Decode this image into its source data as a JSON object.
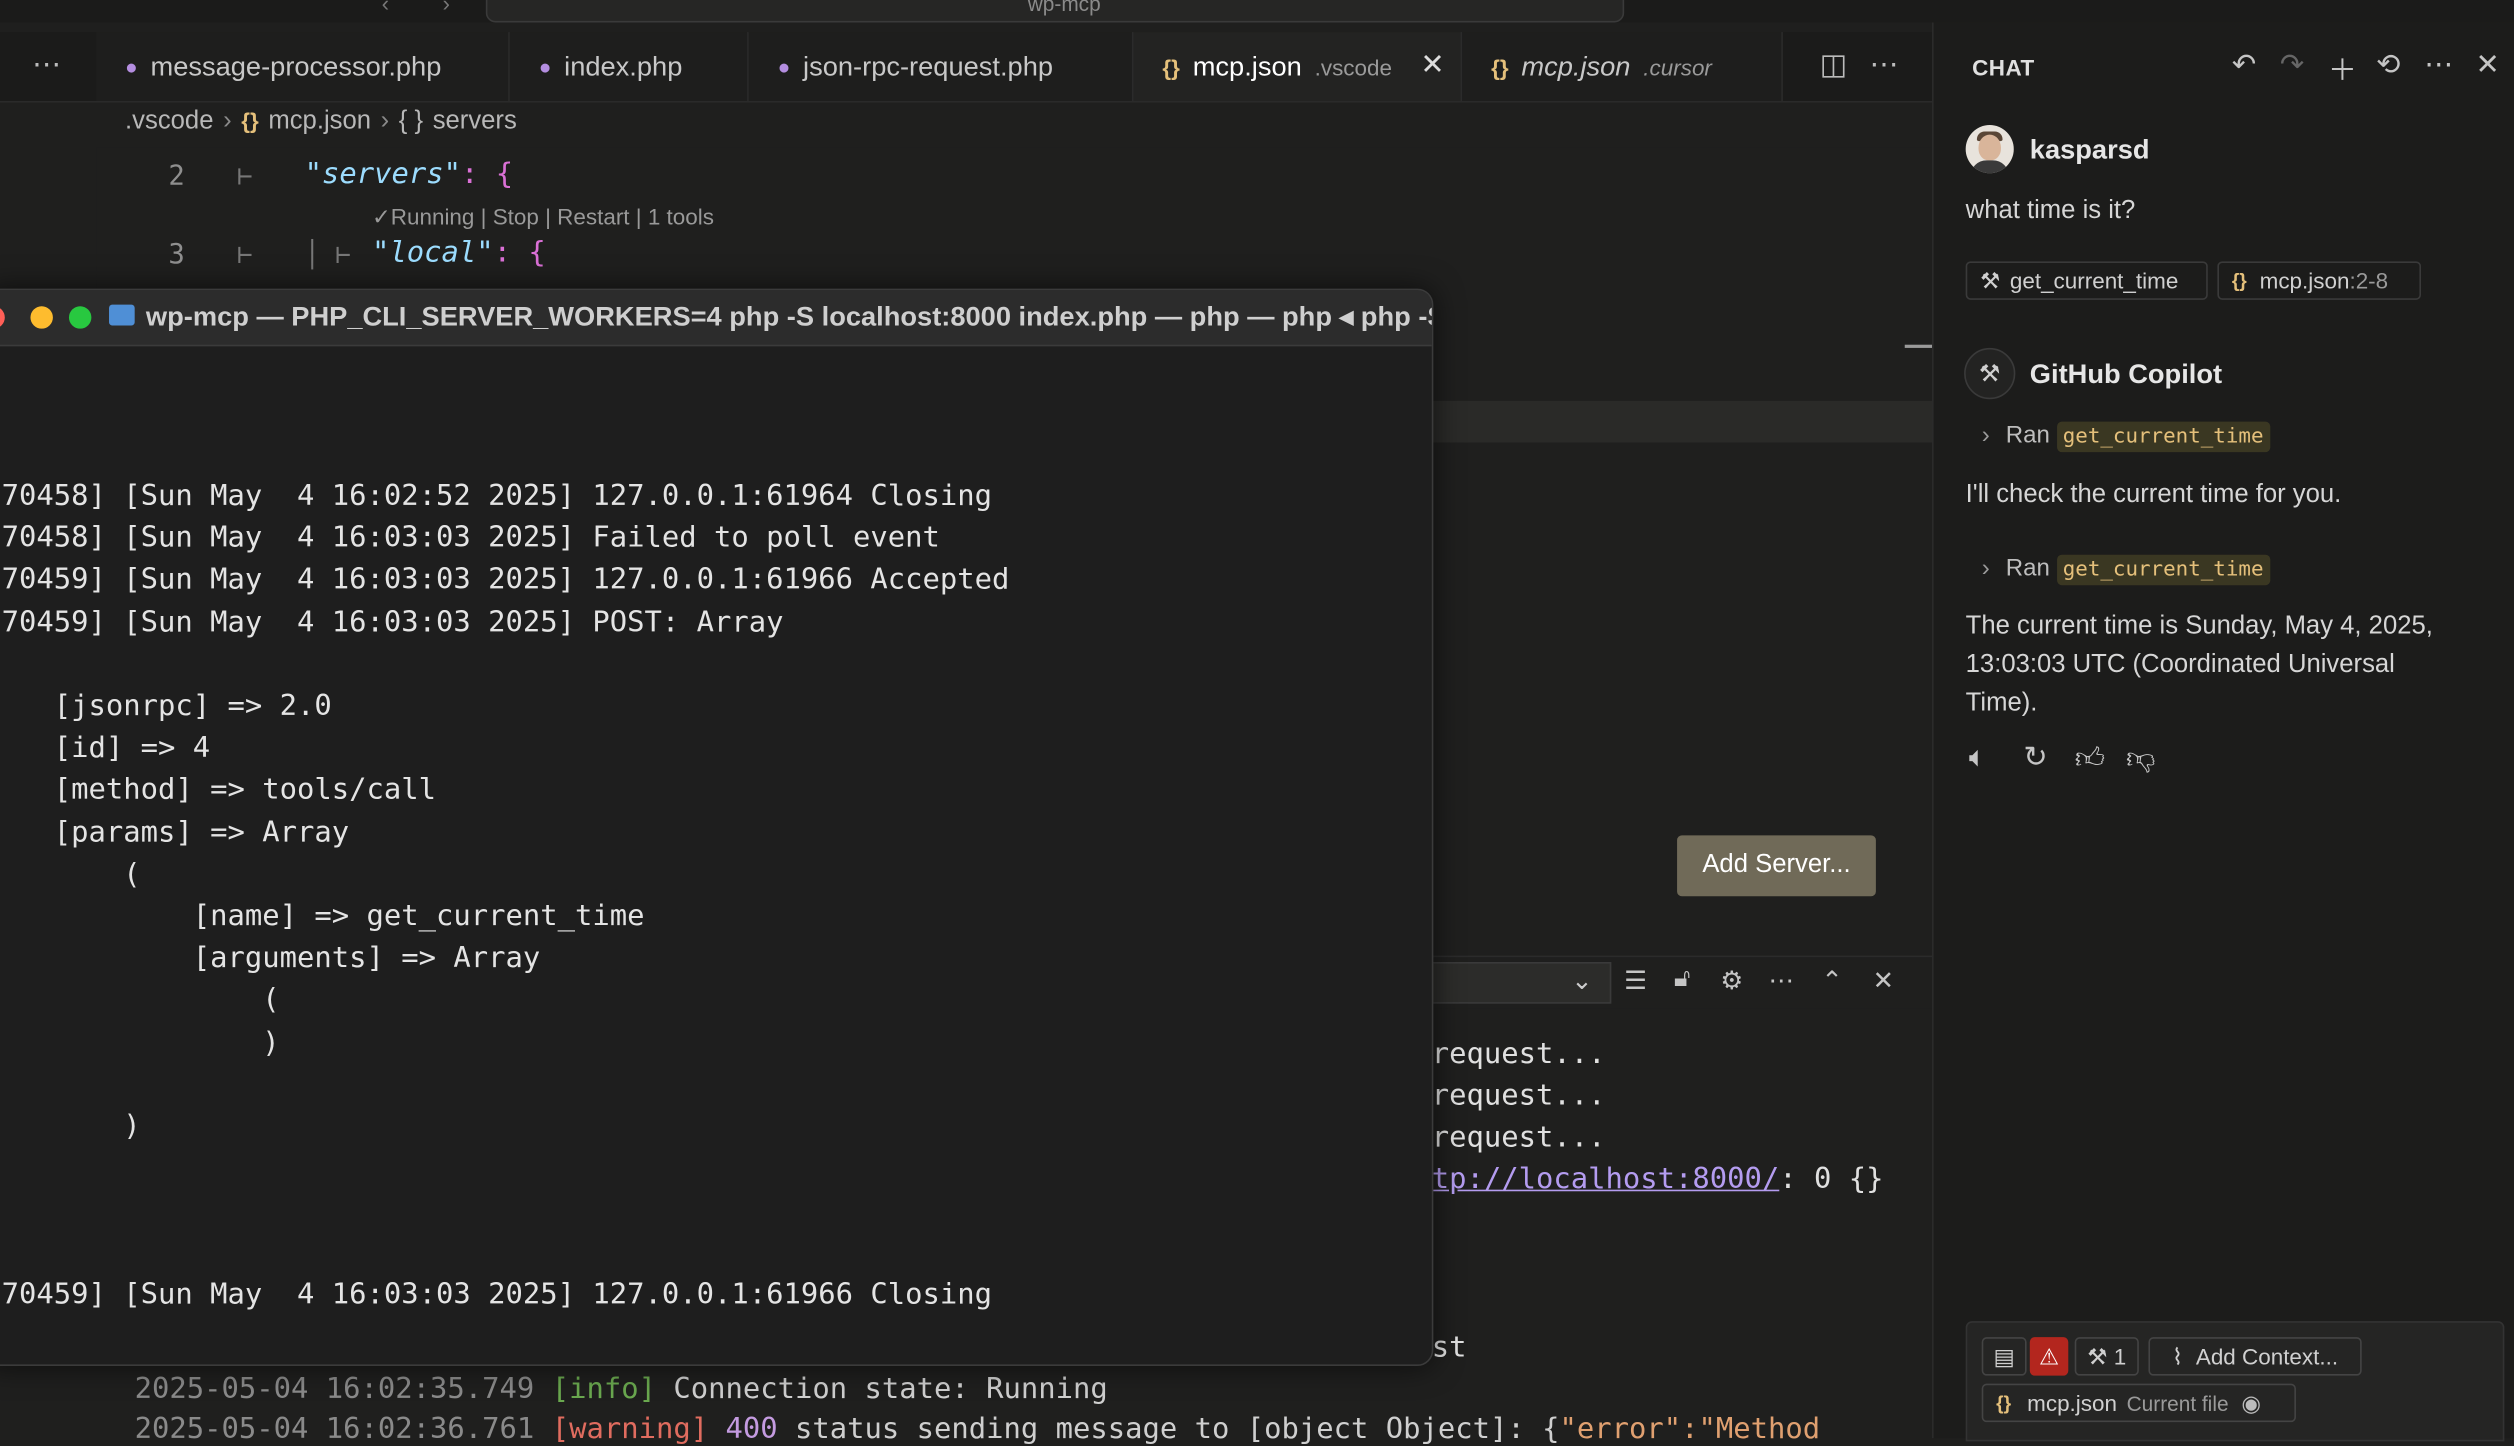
{
  "titlebar": {
    "search_text": "wp-mcp"
  },
  "tabs": [
    {
      "label": "message-processor.php",
      "icon": "php-elephant-icon"
    },
    {
      "label": "index.php",
      "icon": "php-elephant-icon"
    },
    {
      "label": "json-rpc-request.php",
      "icon": "php-elephant-icon"
    },
    {
      "label": "mcp.json",
      "sub": ".vscode",
      "icon": "json-braces-icon",
      "active": true
    },
    {
      "label": "mcp.json",
      "sub": ".cursor",
      "icon": "json-braces-icon",
      "italic": true
    }
  ],
  "breadcrumb": {
    "folder": ".vscode",
    "file": "mcp.json",
    "symbol": "servers",
    "symbol_icon": "{ }"
  },
  "editor": {
    "line2_num": "2",
    "line2_key": "\"servers\"",
    "line2_rest": ": {",
    "codelens": "✓Running | Stop | Restart | 1 tools",
    "line3_num": "3",
    "line3_key": "\"local\"",
    "line3_rest": ": {"
  },
  "add_server_label": "Add Server...",
  "output_lines": [
    "request...",
    "request...",
    "request...",
    "tp://localhost:8000/",
    ": 0 {}",
    "st"
  ],
  "log": {
    "line1_ts": "2025-05-04 16:02:35.749",
    "line1_level": "[info]",
    "line1_msg": " Connection state: Running",
    "line2_ts": "2025-05-04 16:02:36.761",
    "line2_level": "[warning]",
    "line2_code": " 400",
    "line2_msg": " status sending message to [object Object]: {",
    "line2_str": "\"error\":\"Method"
  },
  "terminal": {
    "title": "wp-mcp — PHP_CLI_SERVER_WORKERS=4 php -S localhost:8000 index.php — php — php ◂ php -S...",
    "lines": [
      "70458] [Sun May  4 16:02:52 2025] 127.0.0.1:61964 Closing",
      "70458] [Sun May  4 16:03:03 2025] Failed to poll event",
      "70459] [Sun May  4 16:03:03 2025] 127.0.0.1:61966 Accepted",
      "70459] [Sun May  4 16:03:03 2025] POST: Array",
      "",
      "   [jsonrpc] => 2.0",
      "   [id] => 4",
      "   [method] => tools/call",
      "   [params] => Array",
      "       (",
      "           [name] => get_current_time",
      "           [arguments] => Array",
      "               (",
      "               )",
      "",
      "       )",
      "",
      "",
      "",
      "70459] [Sun May  4 16:03:03 2025] 127.0.0.1:61966 Closing"
    ]
  },
  "chat": {
    "title": "CHAT",
    "user": "kasparsd",
    "user_message": "what time is it?",
    "context_chips": [
      {
        "label": "get_current_time",
        "icon": "tools-icon"
      },
      {
        "label": "mcp.json",
        "range": ":2-8",
        "icon": "json-braces-icon"
      }
    ],
    "assistant": "GitHub Copilot",
    "ran_label": "Ran",
    "ran_tool_1": "get_current_time",
    "assistant_msg_1": "I'll check the current time for you.",
    "ran_tool_2": "get_current_time",
    "assistant_msg_2": "The current time is Sunday, May 4, 2025, 13:03:03 UTC (Coordinated Universal Time).",
    "input": {
      "tools_count": "1",
      "add_context": "Add Context...",
      "current_file": "mcp.json",
      "current_file_label": "Current file"
    }
  },
  "colors": {
    "accent_button": "#706a58",
    "json_icon": "#e5c07b",
    "php_icon": "#b48ee0",
    "error_badge": "#b3261e"
  }
}
